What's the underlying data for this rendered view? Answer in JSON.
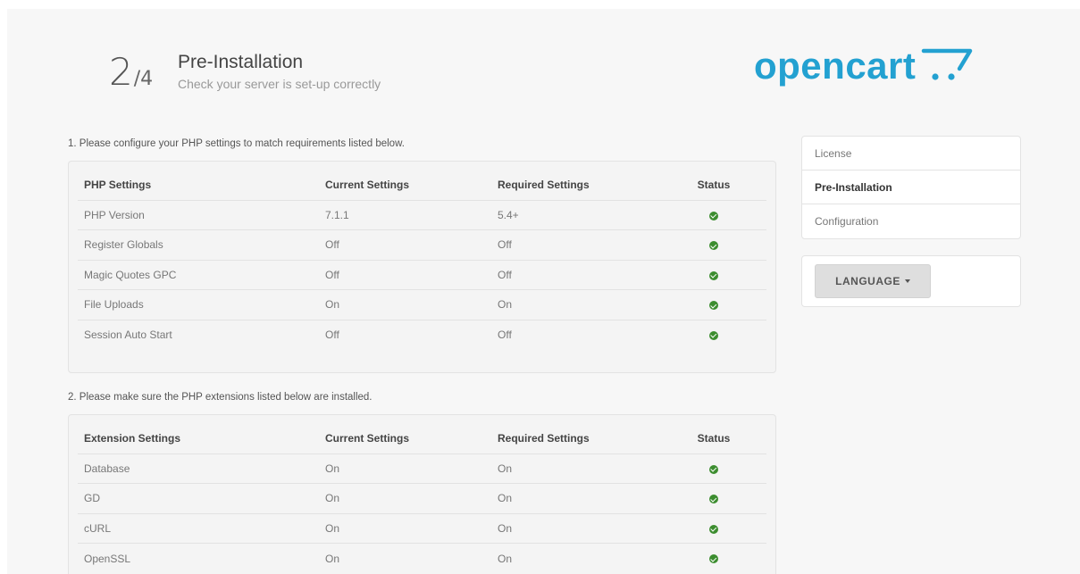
{
  "header": {
    "step_current": "2",
    "step_total": "/4",
    "title": "Pre-Installation",
    "subtitle": "Check your server is set-up correctly",
    "logo_text": "opencart",
    "logo_color": "#23a1d1"
  },
  "section1": {
    "label": "1. Please configure your PHP settings to match requirements listed below.",
    "columns": [
      "PHP Settings",
      "Current Settings",
      "Required Settings",
      "Status"
    ],
    "rows": [
      {
        "name": "PHP Version",
        "current": "7.1.1",
        "required": "5.4+",
        "status": "ok"
      },
      {
        "name": "Register Globals",
        "current": "Off",
        "required": "Off",
        "status": "ok"
      },
      {
        "name": "Magic Quotes GPC",
        "current": "Off",
        "required": "Off",
        "status": "ok"
      },
      {
        "name": "File Uploads",
        "current": "On",
        "required": "On",
        "status": "ok"
      },
      {
        "name": "Session Auto Start",
        "current": "Off",
        "required": "Off",
        "status": "ok"
      }
    ]
  },
  "section2": {
    "label": "2. Please make sure the PHP extensions listed below are installed.",
    "columns": [
      "Extension Settings",
      "Current Settings",
      "Required Settings",
      "Status"
    ],
    "rows": [
      {
        "name": "Database",
        "current": "On",
        "required": "On",
        "status": "ok"
      },
      {
        "name": "GD",
        "current": "On",
        "required": "On",
        "status": "ok"
      },
      {
        "name": "cURL",
        "current": "On",
        "required": "On",
        "status": "ok"
      },
      {
        "name": "OpenSSL",
        "current": "On",
        "required": "On",
        "status": "ok"
      }
    ]
  },
  "sidebar": {
    "items": [
      {
        "label": "License",
        "active": false
      },
      {
        "label": "Pre-Installation",
        "active": true
      },
      {
        "label": "Configuration",
        "active": false
      }
    ],
    "language_button": "LANGUAGE"
  },
  "colors": {
    "status_ok": "#3c8d2f",
    "brand": "#23a1d1"
  }
}
